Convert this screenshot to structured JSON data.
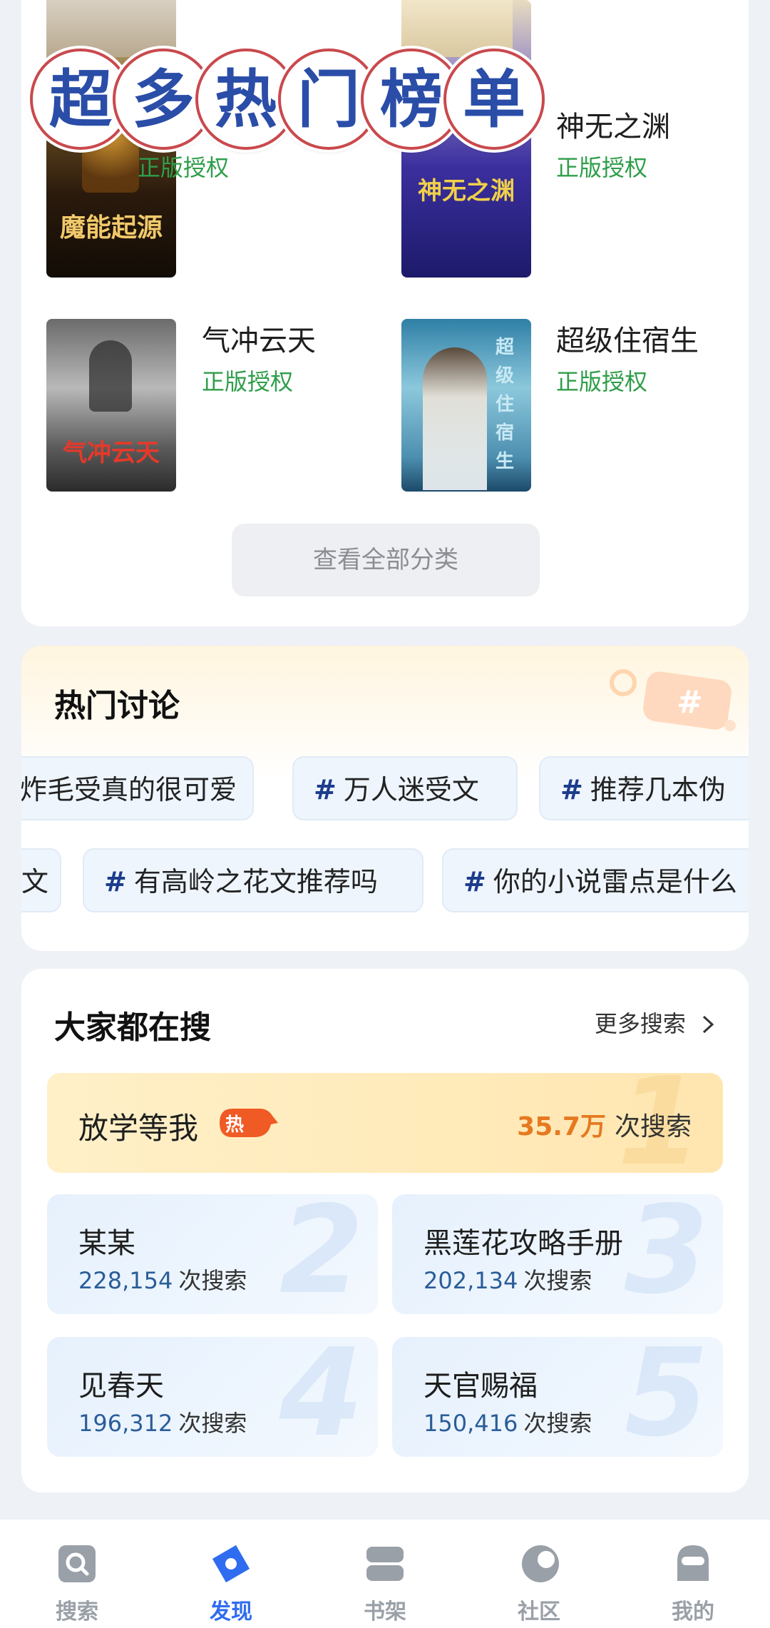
{
  "banner": {
    "chars": [
      "超",
      "多",
      "热",
      "门",
      "榜",
      "单"
    ]
  },
  "books": {
    "items": [
      {
        "title": "",
        "badge": "正版授权",
        "cover_text": "魔能起源"
      },
      {
        "title": "神无之渊",
        "badge": "正版授权",
        "cover_text": "神无之渊"
      },
      {
        "title": "气冲云天",
        "badge": "正版授权",
        "cover_text": "气冲云天"
      },
      {
        "title": "超级住宿生",
        "badge": "正版授权",
        "cover_text": "超级住宿生"
      }
    ],
    "view_all": "查看全部分类"
  },
  "discussion": {
    "title": "热门讨论",
    "row1": [
      "炸毛受真的很可爱",
      "万人迷受文",
      "推荐几本伪"
    ],
    "row2": [
      "文",
      "有高岭之花文推荐吗",
      "你的小说雷点是什么"
    ],
    "hash": "#"
  },
  "search": {
    "title": "大家都在搜",
    "more": "更多搜索",
    "top": {
      "rank": "1",
      "name": "放学等我",
      "hot": "热",
      "count": "35.7万",
      "suffix": "次搜索"
    },
    "items": [
      {
        "rank": "2",
        "name": "某某",
        "count": "228,154",
        "suffix": "次搜索"
      },
      {
        "rank": "3",
        "name": "黑莲花攻略手册",
        "count": "202,134",
        "suffix": "次搜索"
      },
      {
        "rank": "4",
        "name": "见春天",
        "count": "196,312",
        "suffix": "次搜索"
      },
      {
        "rank": "5",
        "name": "天官赐福",
        "count": "150,416",
        "suffix": "次搜索"
      }
    ]
  },
  "nav": {
    "items": [
      {
        "label": "搜索",
        "icon": "search-icon"
      },
      {
        "label": "发现",
        "icon": "discover-icon"
      },
      {
        "label": "书架",
        "icon": "bookshelf-icon"
      },
      {
        "label": "社区",
        "icon": "community-icon"
      },
      {
        "label": "我的",
        "icon": "profile-icon"
      }
    ],
    "active": "发现",
    "active_color": "#2f6cf0",
    "inactive_color": "#9aa0a8"
  }
}
